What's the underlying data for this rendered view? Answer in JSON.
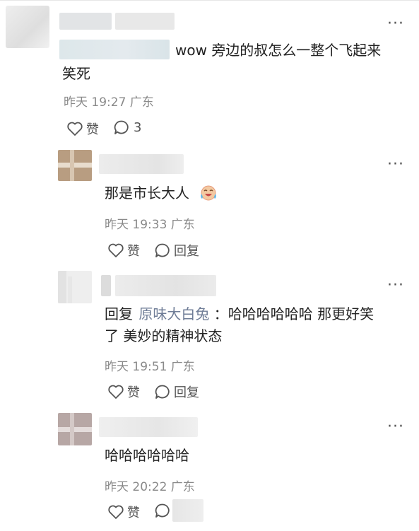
{
  "comments": [
    {
      "text_prefix": "wow ",
      "text_main": "旁边的叔怎么一整个飞起来",
      "text_line2": "笑死",
      "meta": "昨天 19:27 广东",
      "like_label": "赞",
      "reply_count": "3",
      "more_label": "···"
    }
  ],
  "replies": [
    {
      "text": "那是市长大人",
      "emoji": "crying-laughing-face-icon",
      "meta": "昨天 19:33 广东",
      "like_label": "赞",
      "reply_label": "回复",
      "more_label": "···"
    },
    {
      "reply_prefix": "回复",
      "mention": "原味大白兔",
      "text_rest": "：哈哈哈哈哈哈 那更好笑",
      "text_line2": "了 美妙的精神状态",
      "meta": "昨天 19:51 广东",
      "like_label": "赞",
      "reply_label": "回复",
      "more_label": "···"
    },
    {
      "text": "哈哈哈哈哈哈",
      "meta": "昨天 20:22 广东",
      "like_label": "赞",
      "more_label": "···"
    }
  ],
  "colors": {
    "text": "#222222",
    "meta": "#8a8a8a",
    "mention": "#6f7d97",
    "icon": "#555555"
  }
}
